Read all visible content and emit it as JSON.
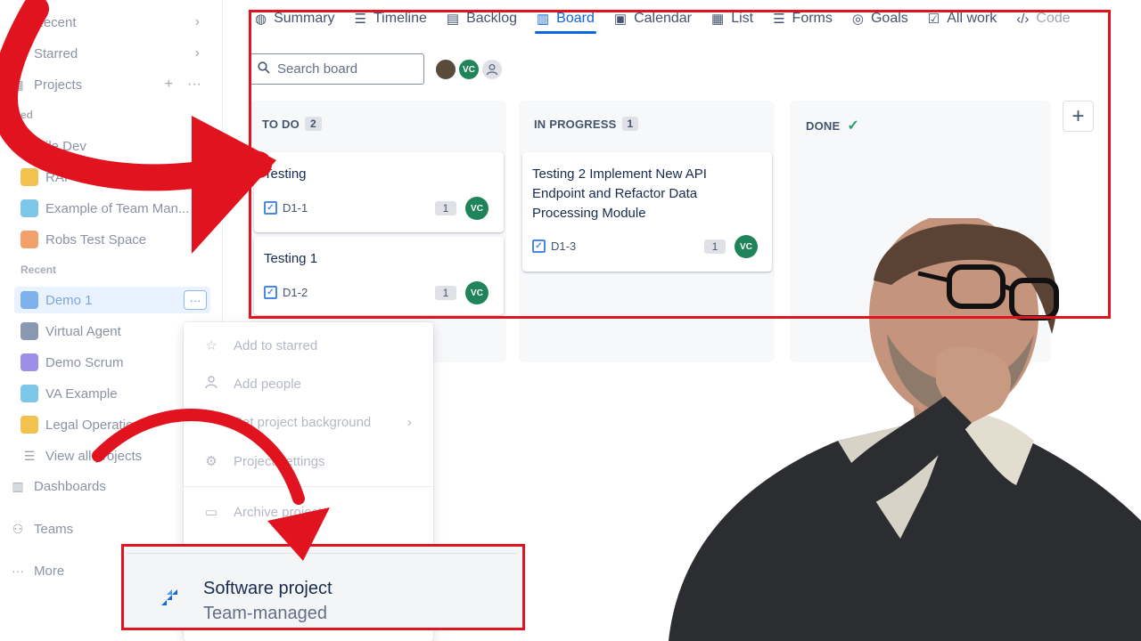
{
  "sidebar": {
    "items": [
      {
        "label": "Recent",
        "icon": "clock-icon"
      },
      {
        "label": "Starred",
        "icon": "star-icon"
      },
      {
        "label": "Projects",
        "icon": "projects-icon"
      }
    ],
    "starred_section": "ed",
    "starred_projects": [
      {
        "label": "ile Dev",
        "color": "#6b8fe0"
      },
      {
        "label": "RAI",
        "color": "#f2c14e"
      },
      {
        "label": "Example of Team Man...",
        "color": "#7cc7e8"
      },
      {
        "label": "Robs Test Space",
        "color": "#f4a06b"
      }
    ],
    "recent_section": "Recent",
    "recent_projects": [
      {
        "label": "Demo 1",
        "color": "#7cb1ec"
      },
      {
        "label": "Virtual Agent",
        "color": "#8a97b0"
      },
      {
        "label": "Demo Scrum",
        "color": "#9c8fe8"
      },
      {
        "label": "VA Example",
        "color": "#7cc7e8"
      },
      {
        "label": "Legal Operation",
        "color": "#f2c14e"
      }
    ],
    "view_all": "View all projects",
    "dashboards": "Dashboards",
    "teams": "Teams",
    "more": "More"
  },
  "tabs": [
    {
      "label": "Summary",
      "icon": "globe-icon",
      "active": false
    },
    {
      "label": "Timeline",
      "icon": "timeline-icon",
      "active": false
    },
    {
      "label": "Backlog",
      "icon": "backlog-icon",
      "active": false
    },
    {
      "label": "Board",
      "icon": "board-icon",
      "active": true
    },
    {
      "label": "Calendar",
      "icon": "calendar-icon",
      "active": false
    },
    {
      "label": "List",
      "icon": "list-icon",
      "active": false
    },
    {
      "label": "Forms",
      "icon": "forms-icon",
      "active": false
    },
    {
      "label": "Goals",
      "icon": "goals-icon",
      "active": false
    },
    {
      "label": "All work",
      "icon": "all-work-icon",
      "active": false
    },
    {
      "label": "Code",
      "icon": "code-icon",
      "active": false
    }
  ],
  "search": {
    "placeholder": "Search board"
  },
  "avatars": [
    {
      "initials": "",
      "color": "#5a4a3a"
    },
    {
      "initials": "VC",
      "color": "#1f845a"
    },
    {
      "initials": "",
      "color": "#dfe1e6"
    }
  ],
  "columns": [
    {
      "title": "TO DO",
      "count": "2",
      "cards": [
        {
          "title": "Testing",
          "key": "D1-1",
          "estimate": "1",
          "assignee": "VC"
        },
        {
          "title": "Testing 1",
          "key": "D1-2",
          "estimate": "1",
          "assignee": "VC"
        }
      ]
    },
    {
      "title": "IN PROGRESS",
      "count": "1",
      "cards": [
        {
          "title": "Testing 2 Implement New API Endpoint and Refactor Data Processing Module",
          "key": "D1-3",
          "estimate": "1",
          "assignee": "VC"
        }
      ]
    },
    {
      "title": "DONE",
      "count": "",
      "cards": []
    }
  ],
  "menu": {
    "items": [
      {
        "label": "Add to starred",
        "icon": "star-icon"
      },
      {
        "label": "Add people",
        "icon": "person-icon"
      },
      {
        "label": "Set project background",
        "icon": "background-icon"
      },
      {
        "label": "Project settings",
        "icon": "gear-icon"
      },
      {
        "label": "Archive project",
        "icon": "archive-icon"
      }
    ]
  },
  "project_type": {
    "title": "Software project",
    "subtitle": "Team-managed"
  },
  "colors": {
    "accent": "#0c66e4",
    "highlight": "#e0131e",
    "arrow": "#e0131e",
    "success": "#22a06b"
  }
}
